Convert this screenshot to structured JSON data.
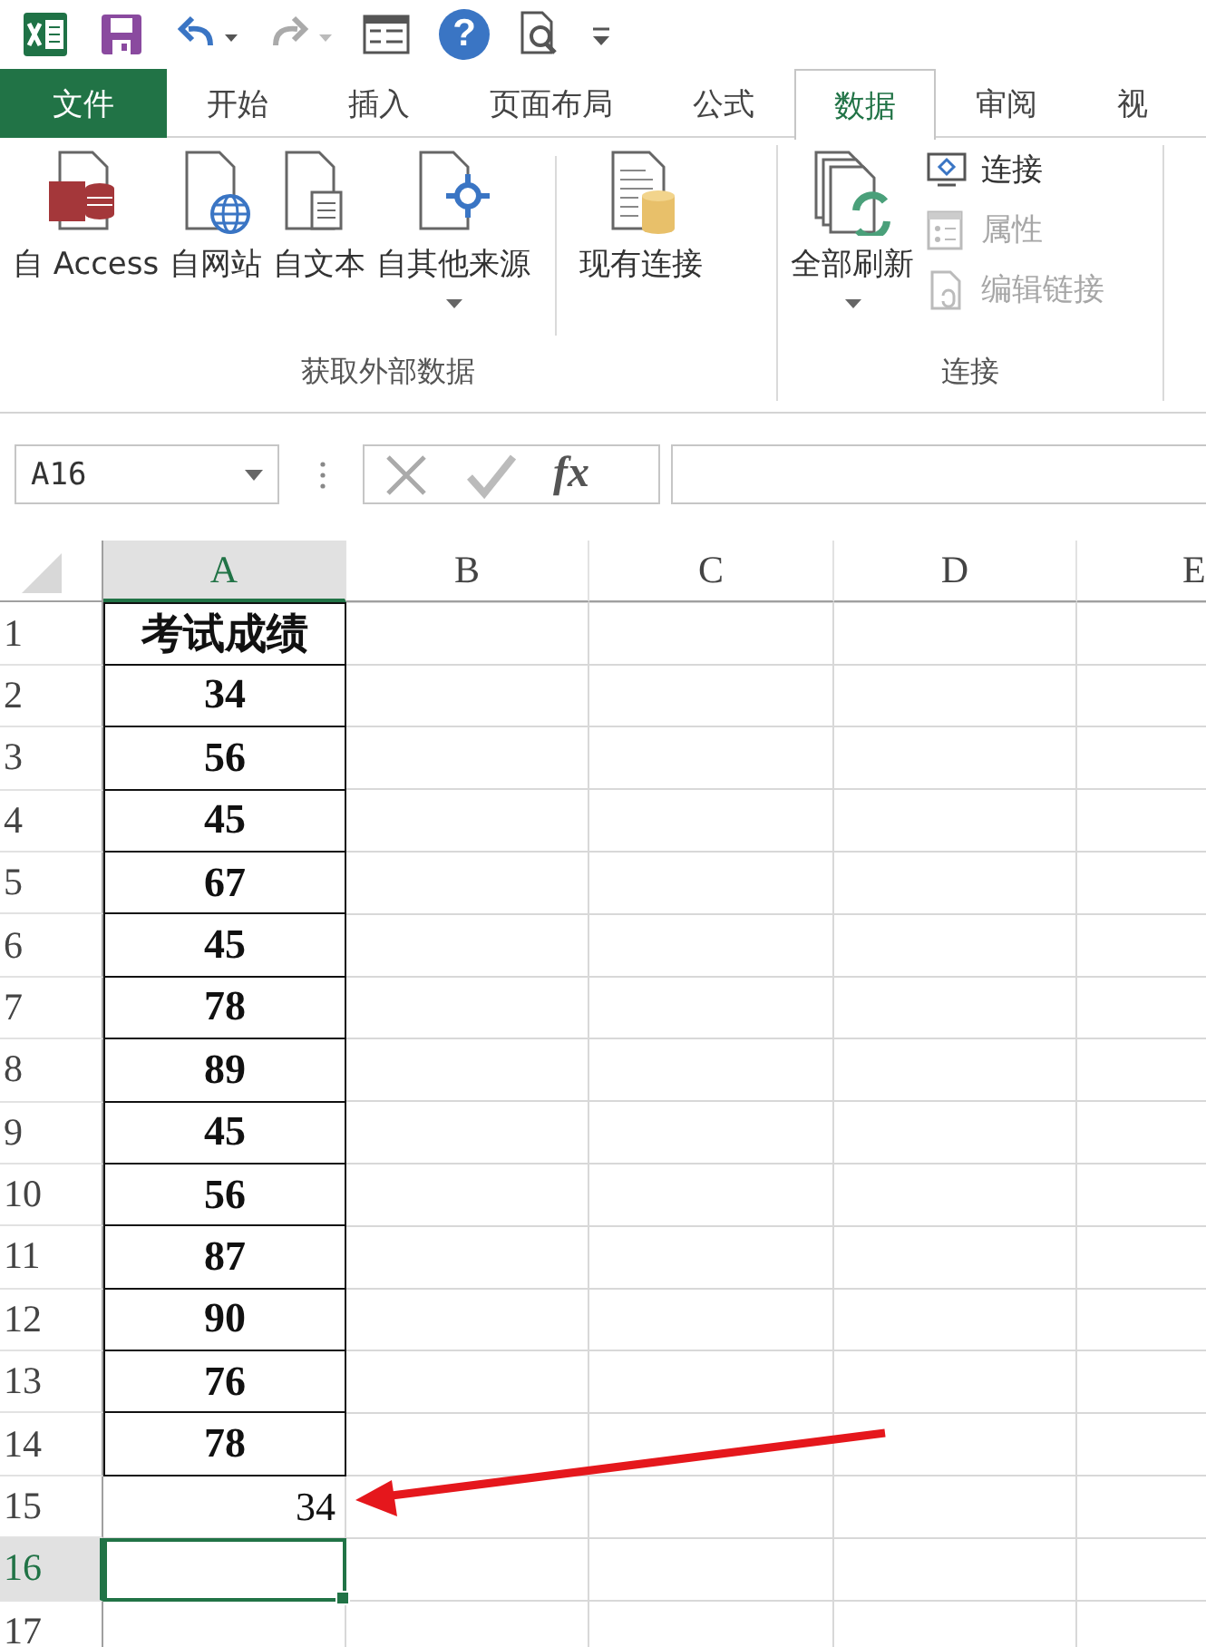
{
  "quick_access": {
    "help_glyph": "?"
  },
  "tabs": [
    {
      "label": "文件",
      "kind": "file",
      "selected": false
    },
    {
      "label": "开始",
      "kind": "tab",
      "selected": false
    },
    {
      "label": "插入",
      "kind": "tab",
      "selected": false
    },
    {
      "label": "页面布局",
      "kind": "tab",
      "selected": false
    },
    {
      "label": "公式",
      "kind": "tab",
      "selected": false
    },
    {
      "label": "数据",
      "kind": "tab",
      "selected": true
    },
    {
      "label": "审阅",
      "kind": "tab",
      "selected": false
    },
    {
      "label": "视",
      "kind": "tab",
      "selected": false
    }
  ],
  "ribbon": {
    "groups": [
      {
        "label": "获取外部数据",
        "sections": [
          [
            {
              "label": "自 Access",
              "kind": "large",
              "dropdown": false,
              "disabled": false
            },
            {
              "label": "自网站",
              "kind": "large",
              "dropdown": false,
              "disabled": false
            },
            {
              "label": "自文本",
              "kind": "large",
              "dropdown": false,
              "disabled": false
            },
            {
              "label": "自其他来源",
              "kind": "large",
              "dropdown": true,
              "disabled": false
            }
          ],
          [
            {
              "label": "现有连接",
              "kind": "large",
              "dropdown": false,
              "disabled": false
            }
          ]
        ]
      },
      {
        "label": "连接",
        "sections": [
          [
            {
              "label": "全部刷新",
              "kind": "large",
              "dropdown": true,
              "disabled": false
            },
            {
              "label": "连接",
              "kind": "small",
              "dropdown": false,
              "disabled": false
            },
            {
              "label": "属性",
              "kind": "small",
              "dropdown": false,
              "disabled": true
            },
            {
              "label": "编辑链接",
              "kind": "small",
              "dropdown": false,
              "disabled": true
            }
          ]
        ]
      }
    ]
  },
  "formula_bar": {
    "name_box": "A16",
    "function_label": "fx"
  },
  "sheet": {
    "columns": [
      {
        "label": "A",
        "selected": true
      },
      {
        "label": "B",
        "selected": false
      },
      {
        "label": "C",
        "selected": false
      },
      {
        "label": "D",
        "selected": false
      },
      {
        "label": "E",
        "selected": false
      }
    ],
    "rows": [
      {
        "header": "1",
        "selected": false,
        "cells": [
          {
            "text": "考试成绩",
            "bold": true,
            "bordered": true,
            "centered": true,
            "active": false
          }
        ]
      },
      {
        "header": "2",
        "selected": false,
        "cells": [
          {
            "text": "34",
            "bold": true,
            "bordered": true,
            "centered": true,
            "active": false
          }
        ]
      },
      {
        "header": "3",
        "selected": false,
        "cells": [
          {
            "text": "56",
            "bold": true,
            "bordered": true,
            "centered": true,
            "active": false
          }
        ]
      },
      {
        "header": "4",
        "selected": false,
        "cells": [
          {
            "text": "45",
            "bold": true,
            "bordered": true,
            "centered": true,
            "active": false
          }
        ]
      },
      {
        "header": "5",
        "selected": false,
        "cells": [
          {
            "text": "67",
            "bold": true,
            "bordered": true,
            "centered": true,
            "active": false
          }
        ]
      },
      {
        "header": "6",
        "selected": false,
        "cells": [
          {
            "text": "45",
            "bold": true,
            "bordered": true,
            "centered": true,
            "active": false
          }
        ]
      },
      {
        "header": "7",
        "selected": false,
        "cells": [
          {
            "text": "78",
            "bold": true,
            "bordered": true,
            "centered": true,
            "active": false
          }
        ]
      },
      {
        "header": "8",
        "selected": false,
        "cells": [
          {
            "text": "89",
            "bold": true,
            "bordered": true,
            "centered": true,
            "active": false
          }
        ]
      },
      {
        "header": "9",
        "selected": false,
        "cells": [
          {
            "text": "45",
            "bold": true,
            "bordered": true,
            "centered": true,
            "active": false
          }
        ]
      },
      {
        "header": "10",
        "selected": false,
        "cells": [
          {
            "text": "56",
            "bold": true,
            "bordered": true,
            "centered": true,
            "active": false
          }
        ]
      },
      {
        "header": "11",
        "selected": false,
        "cells": [
          {
            "text": "87",
            "bold": true,
            "bordered": true,
            "centered": true,
            "active": false
          }
        ]
      },
      {
        "header": "12",
        "selected": false,
        "cells": [
          {
            "text": "90",
            "bold": true,
            "bordered": true,
            "centered": true,
            "active": false
          }
        ]
      },
      {
        "header": "13",
        "selected": false,
        "cells": [
          {
            "text": "76",
            "bold": true,
            "bordered": true,
            "centered": true,
            "active": false
          }
        ]
      },
      {
        "header": "14",
        "selected": false,
        "cells": [
          {
            "text": "78",
            "bold": true,
            "bordered": true,
            "centered": true,
            "active": false
          }
        ]
      },
      {
        "header": "15",
        "selected": false,
        "cells": [
          {
            "text": "34",
            "bold": false,
            "bordered": false,
            "centered": false,
            "active": false
          }
        ]
      },
      {
        "header": "16",
        "selected": true,
        "cells": [
          {
            "active": true
          }
        ]
      },
      {
        "header": "17",
        "selected": false,
        "cells": []
      }
    ]
  }
}
